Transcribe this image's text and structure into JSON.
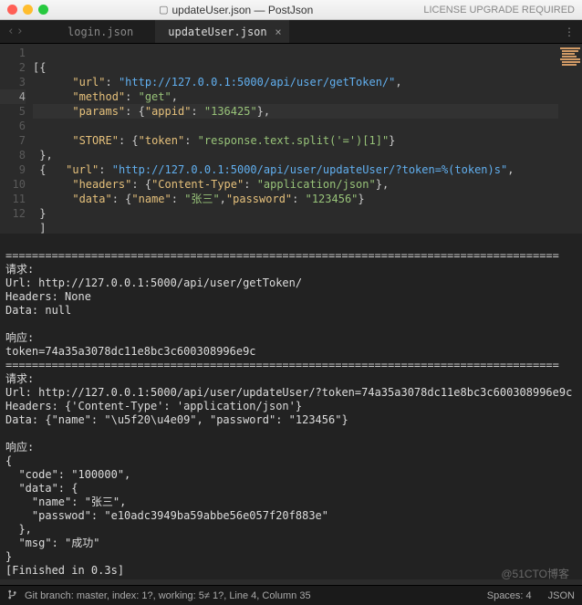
{
  "titlebar": {
    "filename": "updateUser.json",
    "project": "PostJson",
    "right": "LICENSE UPGRADE REQUIRED"
  },
  "tabs": {
    "nav_back": "‹",
    "nav_fwd": "›",
    "items": [
      {
        "label": "login.json",
        "active": false
      },
      {
        "label": "updateUser.json",
        "active": true
      }
    ],
    "overflow": "⋮"
  },
  "editor": {
    "highlight_line": 4,
    "lines": [
      "1",
      "2",
      "3",
      "4",
      "5",
      "6",
      "7",
      "8",
      "9",
      "10",
      "11",
      "12"
    ],
    "code": {
      "l1": "[{",
      "l2_k": "\"url\"",
      "l2_v": "\"http://127.0.0.1:5000/api/user/getToken/\"",
      "l3_k": "\"method\"",
      "l3_v": "\"get\"",
      "l4_k": "\"params\"",
      "l4_ak": "\"appid\"",
      "l4_av": "\"136425\"",
      "l5_k": "\"STORE\"",
      "l5_ak": "\"token\"",
      "l5_av": "\"response.text.split('=')[1]\"",
      "l6": "},",
      "l7_k": "\"url\"",
      "l7_v": "\"http://127.0.0.1:5000/api/user/updateUser/?token=%(token)s\"",
      "l8_k": "\"headers\"",
      "l8_ak": "\"Content-Type\"",
      "l8_av": "\"application/json\"",
      "l9_k": "\"data\"",
      "l9_ak1": "\"name\"",
      "l9_av1": "\"张三\"",
      "l9_ak2": "\"password\"",
      "l9_av2": "\"123456\"",
      "l10": "}",
      "l11": "]"
    }
  },
  "console": {
    "sep": "====================================================================================",
    "req1_label": "请求:",
    "req1_url": "Url: http://127.0.0.1:5000/api/user/getToken/",
    "req1_headers": "Headers: None",
    "req1_data": "Data: null",
    "resp1_label": "响应:",
    "resp1_body": "token=74a35a3078dc11e8bc3c600308996e9c",
    "req2_label": "请求:",
    "req2_url": "Url: http://127.0.0.1:5000/api/user/updateUser/?token=74a35a3078dc11e8bc3c600308996e9c",
    "req2_headers": "Headers: {'Content-Type': 'application/json'}",
    "req2_data": "Data: {\"name\": \"\\u5f20\\u4e09\", \"password\": \"123456\"}",
    "resp2_label": "响应:",
    "resp2_body": "{\n  \"code\": \"100000\",\n  \"data\": {\n    \"name\": \"张三\",\n    \"passwod\": \"e10adc3949ba59abbe56e057f20f883e\"\n  },\n  \"msg\": \"成功\"\n}",
    "finished": "[Finished in 0.3s]"
  },
  "statusbar": {
    "left": "Git branch: master, index: 1?, working: 5≠ 1?, Line 4, Column 35",
    "spaces": "Spaces: 4",
    "syntax": "JSON"
  },
  "watermark": "@51CTO博客"
}
